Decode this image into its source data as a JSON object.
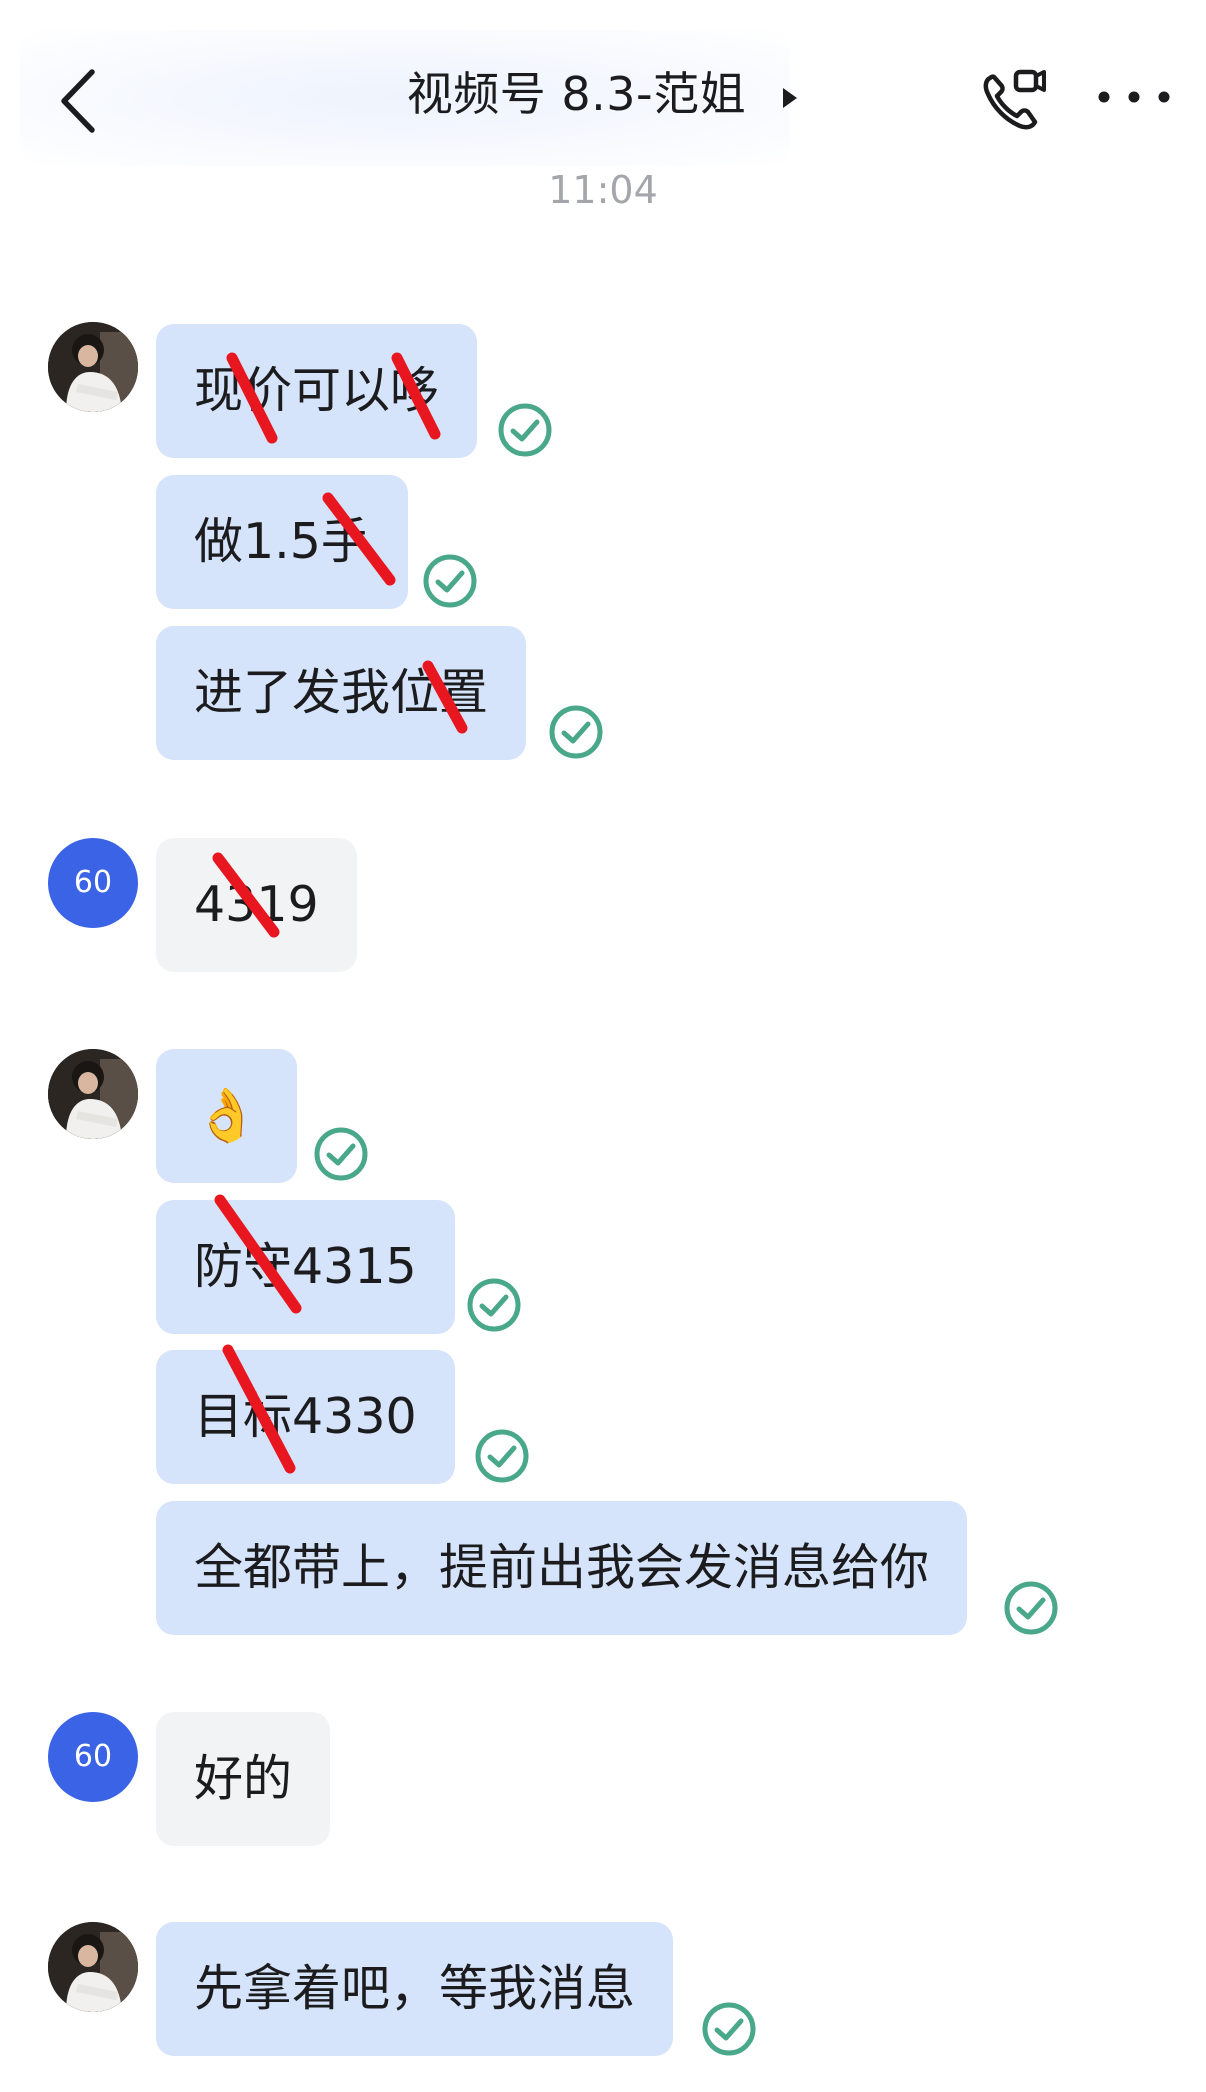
{
  "header": {
    "title": "视频号 8.3-范姐",
    "back_icon": "chevron-left-icon",
    "call_icon": "phone-video-icon",
    "more_icon": "more-dots-icon"
  },
  "time": "11:04",
  "colors": {
    "sent_bubble": "#d5e3fb",
    "received_bubble": "#f2f3f5",
    "avatar_blue": "#3a63e6",
    "check_green": "#4aa88a",
    "strike_red": "#e8161f"
  },
  "avatars": {
    "blue_label": "60"
  },
  "messages": [
    {
      "text": "现价可以哆",
      "from": "photo-avatar",
      "read": true
    },
    {
      "text": "做1.5手",
      "from": "photo-avatar",
      "read": true
    },
    {
      "text": "进了发我位置",
      "from": "photo-avatar",
      "read": true
    },
    {
      "text": "4319",
      "from": "blue-avatar"
    },
    {
      "text": "👌",
      "from": "photo-avatar",
      "read": true
    },
    {
      "text": "防守4315",
      "from": "photo-avatar",
      "read": true
    },
    {
      "text": "目标4330",
      "from": "photo-avatar",
      "read": true
    },
    {
      "text": "全都带上，提前出我会发消息给你",
      "from": "photo-avatar",
      "read": true
    },
    {
      "text": "好的",
      "from": "blue-avatar"
    },
    {
      "text": "先拿着吧，等我消息",
      "from": "photo-avatar",
      "read": true
    }
  ]
}
